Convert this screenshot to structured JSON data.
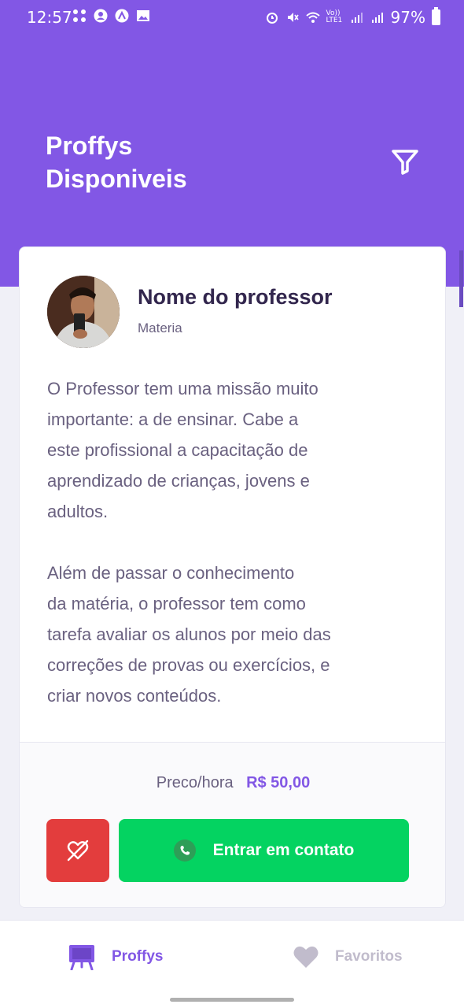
{
  "status_bar": {
    "time": "12:57",
    "battery_percent": "97%",
    "network_label": "Vo)) LTE1"
  },
  "header": {
    "title": "Proffys\nDisponiveis",
    "filter_icon": "filter-icon",
    "background_color": "#8257E5"
  },
  "teacher_card": {
    "name": "Nome do professor",
    "subject": "Materia",
    "bio": "O Professor tem uma missão muito\nimportante: a de ensinar. Cabe a\neste profissional a capacitação de\naprendizado de crianças, jovens e\nadultos.\n\nAlém de passar o conhecimento\nda matéria, o professor tem como\ntarefa avaliar os alunos por meio das\ncorreções de provas ou exercícios, e\ncriar novos conteúdos.",
    "price_label": "Preco/hora",
    "price_value": "R$ 50,00",
    "unfavorite_icon": "heart-off-icon",
    "contact_label": "Entrar em contato",
    "contact_icon": "whatsapp-icon"
  },
  "tabbar": {
    "items": [
      {
        "label": "Proffys",
        "icon": "easel-icon",
        "active": true
      },
      {
        "label": "Favoritos",
        "icon": "heart-icon",
        "active": false
      }
    ]
  },
  "colors": {
    "primary": "#8257E5",
    "danger": "#E33D3D",
    "success": "#04D361",
    "inactive": "#C1BCCC"
  }
}
